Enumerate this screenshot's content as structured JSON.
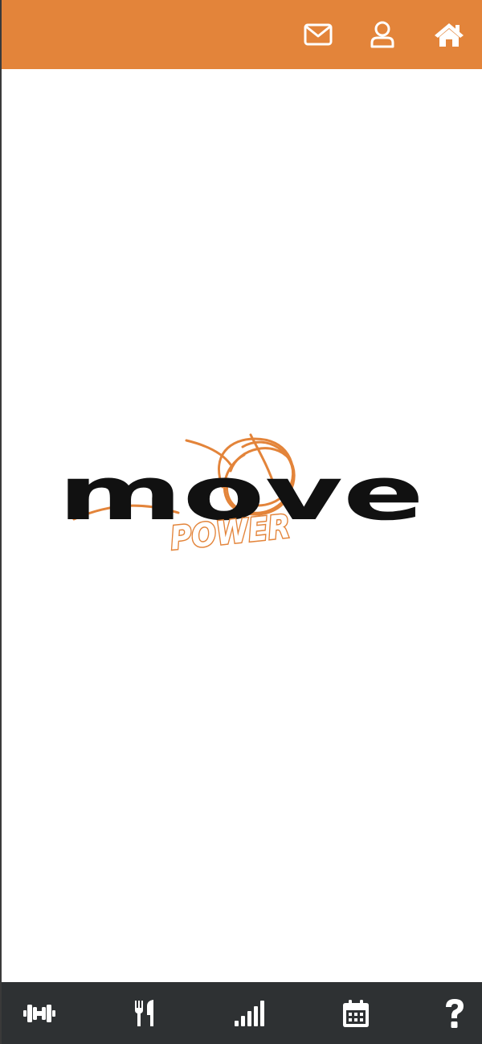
{
  "colors": {
    "header_bg": "#e3843a",
    "nav_bg": "#2e3133",
    "icon": "#ffffff",
    "logo_black": "#111111",
    "logo_orange": "#e3843a"
  },
  "header": {
    "icons": [
      "mail-icon",
      "user-profile-icon",
      "home-icon"
    ]
  },
  "logo": {
    "word": "move",
    "sub": "POWER"
  },
  "bottom_nav": {
    "icons": [
      "dumbbell-icon",
      "fork-knife-icon",
      "signal-bars-icon",
      "calendar-icon",
      "question-mark-icon"
    ]
  }
}
